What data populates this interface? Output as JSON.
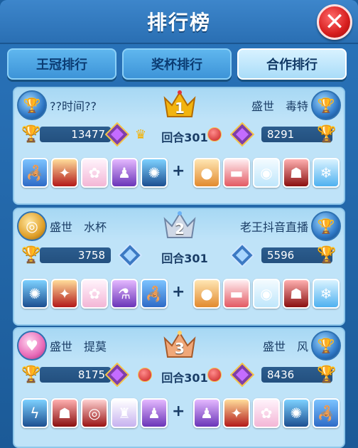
{
  "title": "排行榜",
  "tabs": [
    {
      "label": "王冠排行",
      "active": false
    },
    {
      "label": "奖杯排行",
      "active": false
    },
    {
      "label": "合作排行",
      "active": true
    }
  ],
  "cards": [
    {
      "rank": "1",
      "crown_color": "#f2b40f",
      "left_player": "??时间??",
      "right_player": "盛世　毒特",
      "left_score": "13477",
      "right_score": "8291",
      "round": "回合301"
    },
    {
      "rank": "2",
      "crown_color": "#cfd8e6",
      "left_player": "盛世　水杯",
      "right_player": "老王抖音直播",
      "left_score": "3758",
      "right_score": "5596",
      "round": "回合301"
    },
    {
      "rank": "3",
      "crown_color": "#f0a879",
      "left_player": "盛世　提莫",
      "right_player": "盛世　风",
      "left_score": "8175",
      "right_score": "8436",
      "round": "回合301"
    }
  ],
  "close_icon": "close-icon",
  "accent": "#1b5a97"
}
